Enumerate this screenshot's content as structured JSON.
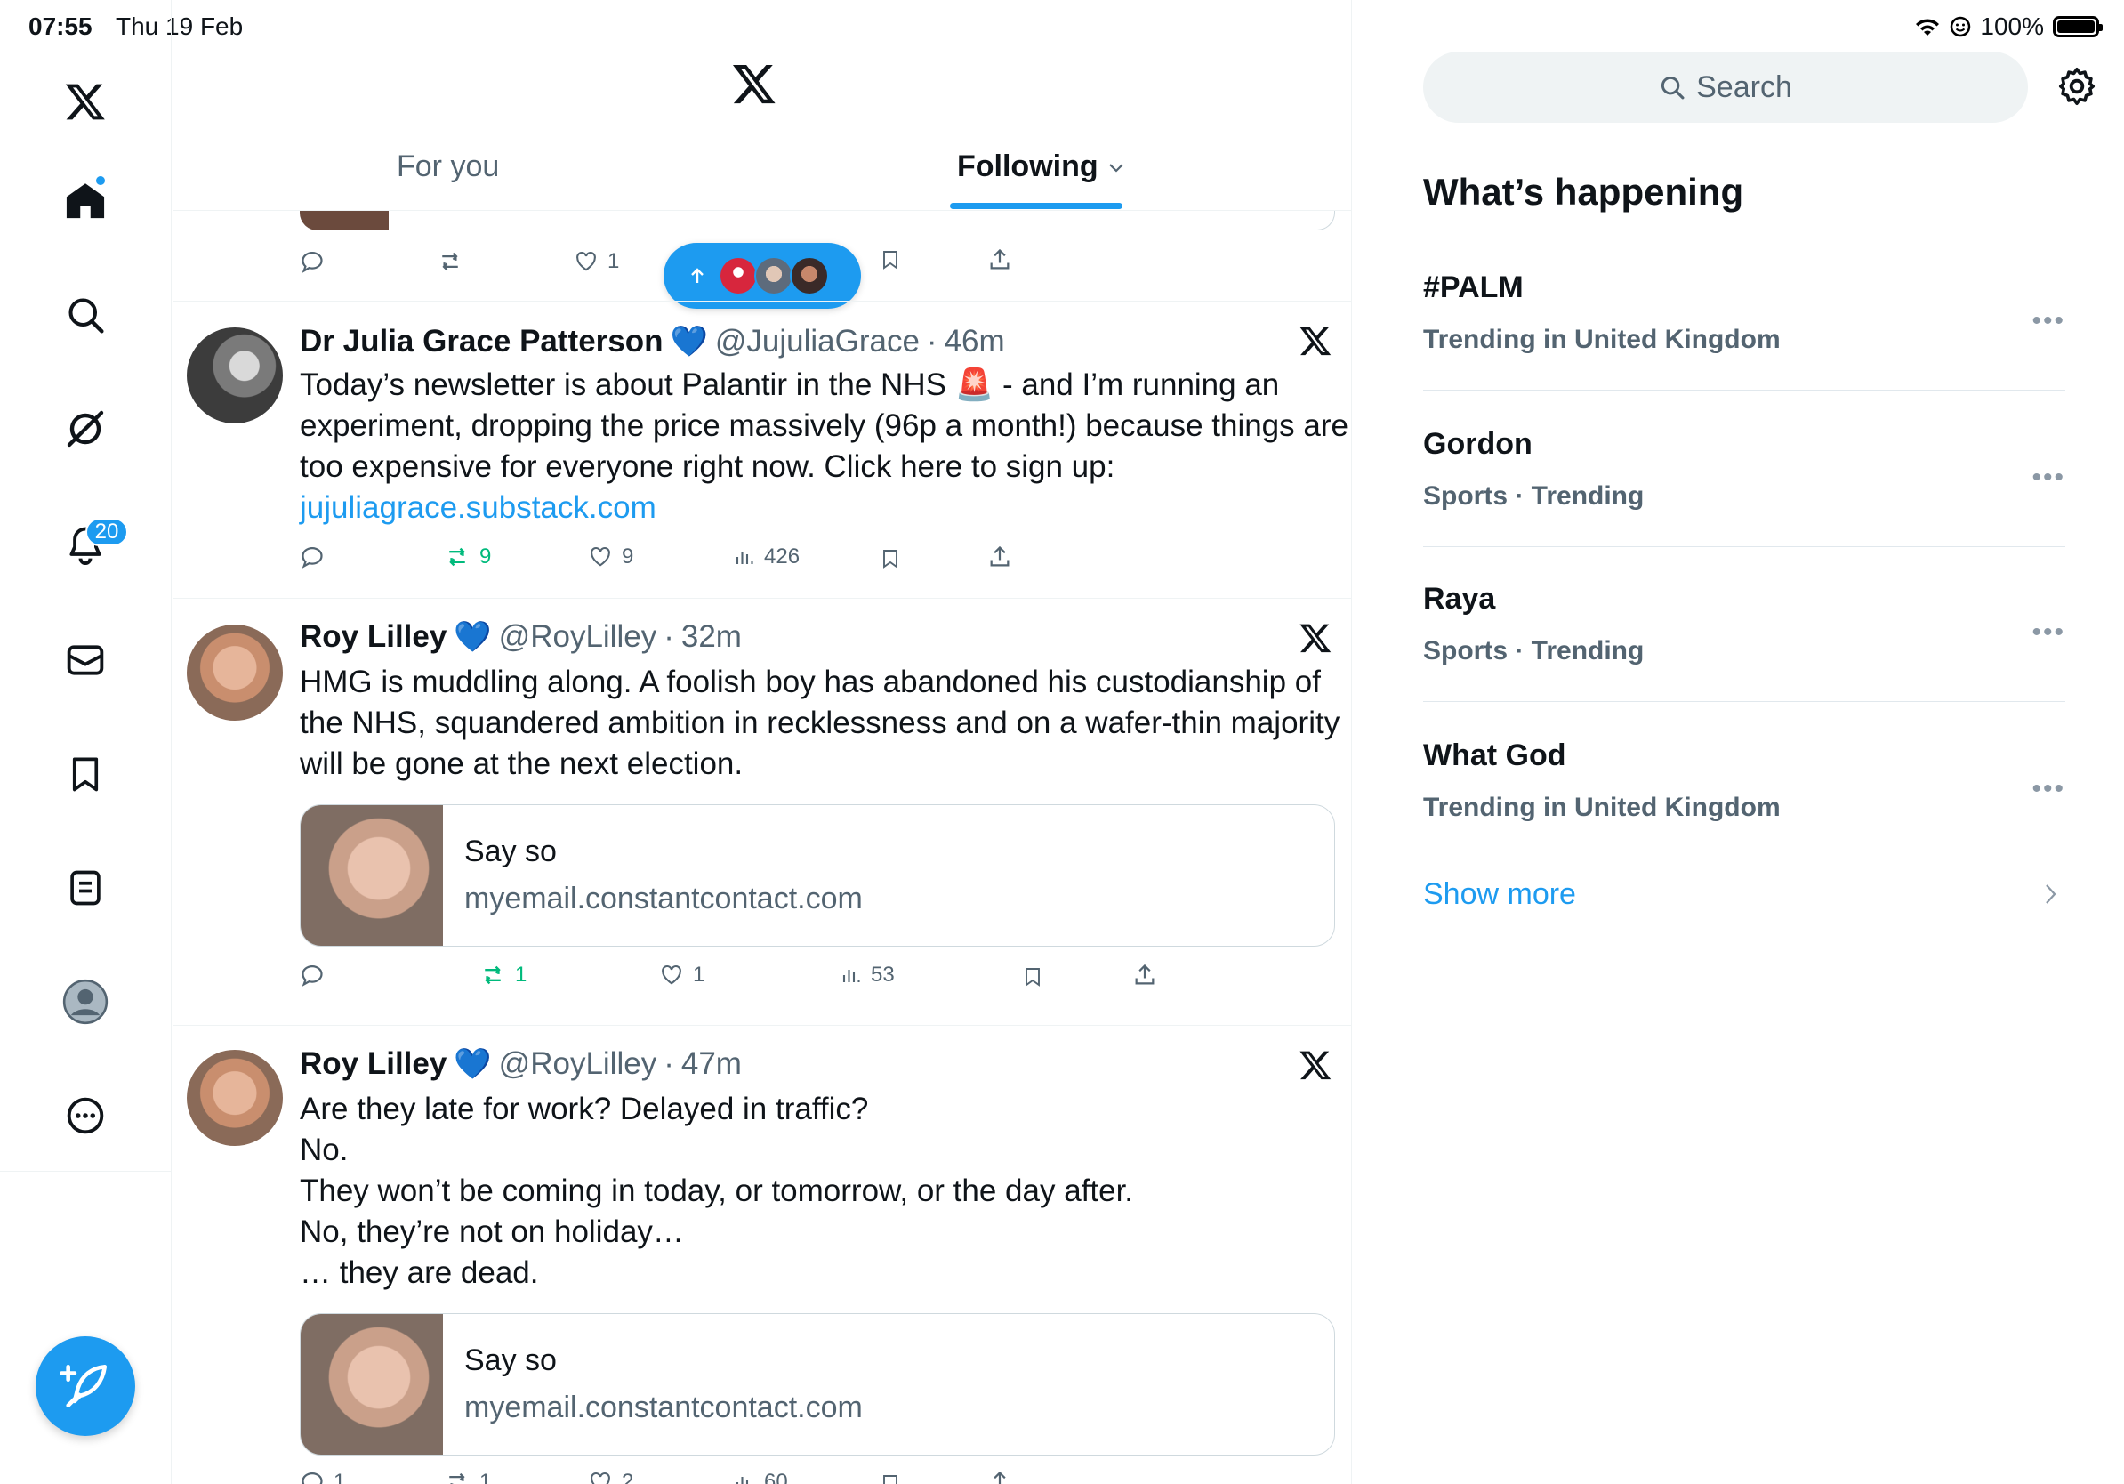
{
  "status_bar": {
    "time": "07:55",
    "date": "Thu 19 Feb",
    "battery": "100%"
  },
  "nav": {
    "notifications_count": "20"
  },
  "tabs": [
    {
      "label": "For you"
    },
    {
      "label": "Following"
    }
  ],
  "first_tweet_partial": {
    "likes": "1"
  },
  "tweets": [
    {
      "name": "Dr Julia Grace Patterson",
      "handle": "@JujuliaGrace",
      "time": "46m",
      "text": "Today’s newsletter is about Palantir in the NHS 🚨 - and I’m running an experiment, dropping the price massively (96p a month!) because things are too expensive for everyone right now. Click here to sign up:",
      "link": "jujuliagrace.substack.com",
      "retweets": "9",
      "likes": "9",
      "views": "426"
    },
    {
      "name": "Roy Lilley",
      "handle": "@RoyLilley",
      "time": "32m",
      "text": "HMG is muddling along. A foolish boy has abandoned his custodianship of the NHS, squandered ambition in recklessness and on a wafer-thin majority will be gone at the next election.",
      "card_title": "Say so",
      "card_domain": "myemail.constantcontact.com",
      "retweets": "1",
      "likes": "1",
      "views": "53"
    },
    {
      "name": "Roy Lilley",
      "handle": "@RoyLilley",
      "time": "47m",
      "lines": [
        "Are they late for work? Delayed in traffic?",
        "No.",
        "They won’t be coming in today, or tomorrow, or the day after.",
        "No, they’re not on holiday…",
        "… they are dead."
      ],
      "card_title": "Say so",
      "card_domain": "myemail.constantcontact.com",
      "replies": "1",
      "retweets": "1",
      "likes": "2",
      "views": "60"
    }
  ],
  "sidebar": {
    "search_placeholder": "Search",
    "whats_happening": "What’s happening",
    "trends": [
      {
        "name": "#PALM",
        "meta": "Trending in United Kingdom"
      },
      {
        "name": "Gordon",
        "meta": "Sports · Trending"
      },
      {
        "name": "Raya",
        "meta": "Sports · Trending"
      },
      {
        "name": "What God",
        "meta": "Trending in United Kingdom"
      }
    ],
    "show_more": "Show more"
  },
  "colors": {
    "accent": "#1d9bf0",
    "retweet_green": "#00ba7c",
    "muted": "#536471"
  }
}
